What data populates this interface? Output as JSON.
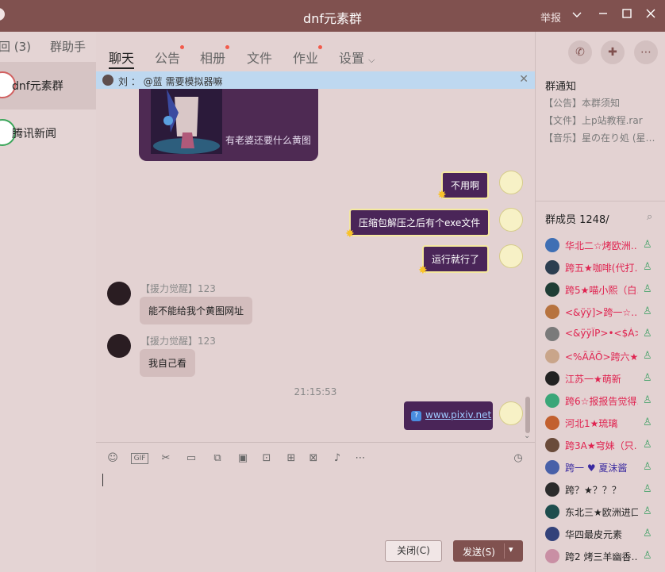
{
  "window": {
    "title": "dnf元素群",
    "report_label": "举报",
    "colors": {
      "titlebar": "#80514f",
      "bg": "#e3d2d2"
    }
  },
  "left_panel": {
    "tab_recent": "回 (3)",
    "tab_assistant": "群助手",
    "conversations": [
      {
        "name": "dnf元素群",
        "icon": "group-avatar"
      },
      {
        "name": "腾讯新闻",
        "icon": "tencent-news-icon"
      }
    ]
  },
  "chat": {
    "tabs": [
      {
        "label": "聊天"
      },
      {
        "label": "公告"
      },
      {
        "label": "相册"
      },
      {
        "label": "文件"
      },
      {
        "label": "作业"
      },
      {
        "label": "设置"
      }
    ],
    "notice_bar": "刘 ： @蓝 需要模拟器嘛",
    "image_caption": "有老婆还要什么黄图",
    "outgoing_messages": [
      "不用啊",
      "压缩包解压之后有个exe文件",
      "运行就行了"
    ],
    "incoming_messages": [
      {
        "sender": "【援力觉醒】123",
        "text": "能不能给我个黄图网址"
      },
      {
        "sender": "【援力觉醒】123",
        "text": "我自己看"
      }
    ],
    "timestamp": "21:15:53",
    "link_message": "www.pixiv.net",
    "buttons": {
      "close": "关闭(C)",
      "send": "发送(S)"
    }
  },
  "right_panel": {
    "group_notice_title": "群通知",
    "notices": [
      "【公告】本群须知",
      "【文件】上p站教程.rar",
      "【音乐】星の在り処 (星…"
    ],
    "members_title": "群成员 1248/",
    "members": [
      "华北二☆烤欧洲…",
      "跨五★咖啡(代打…",
      "跨5★喵小熙（白…",
      "<&ÿÿ]>跨一☆…",
      "<&ÿÿÏP>•<$À>…",
      "<%ÃÃÕ>跨六★…",
      "江苏一★萌新",
      "跨6☆报报告觉得…",
      "河北1★琉璃",
      "跨3A★穹妹（只…",
      "跨一 ♥ 夏沫酱",
      "跨？★？？？",
      "东北三★欧洲进口…",
      "华四最皮元素",
      "跨2 烤三羊幽香…"
    ]
  }
}
